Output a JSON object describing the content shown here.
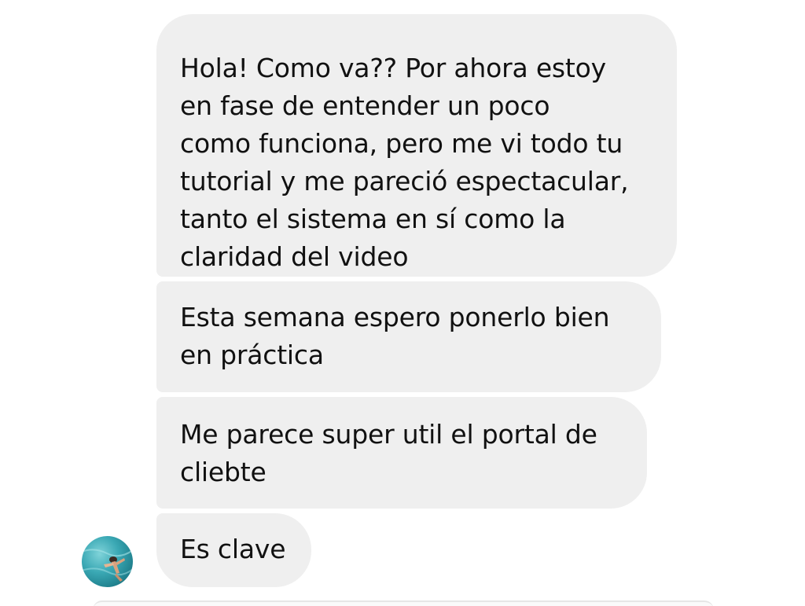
{
  "messages": [
    {
      "text": "Hola! Como va?? Por ahora estoy\nen fase de entender un poco\ncomo funciona, pero me vi todo tu\ntutorial y me pareció espectacular,\ntanto el sistema en sí como la\nclaridad del video"
    },
    {
      "text": "Esta semana espero ponerlo bien\nen práctica"
    },
    {
      "text": "Me parece super util el portal de\ncliebte"
    },
    {
      "text": "Es clave"
    }
  ],
  "colors": {
    "bubble_background": "#efefef",
    "text": "#111111",
    "page_background": "#ffffff"
  },
  "icons": {
    "avatar": "sender-avatar-image"
  }
}
